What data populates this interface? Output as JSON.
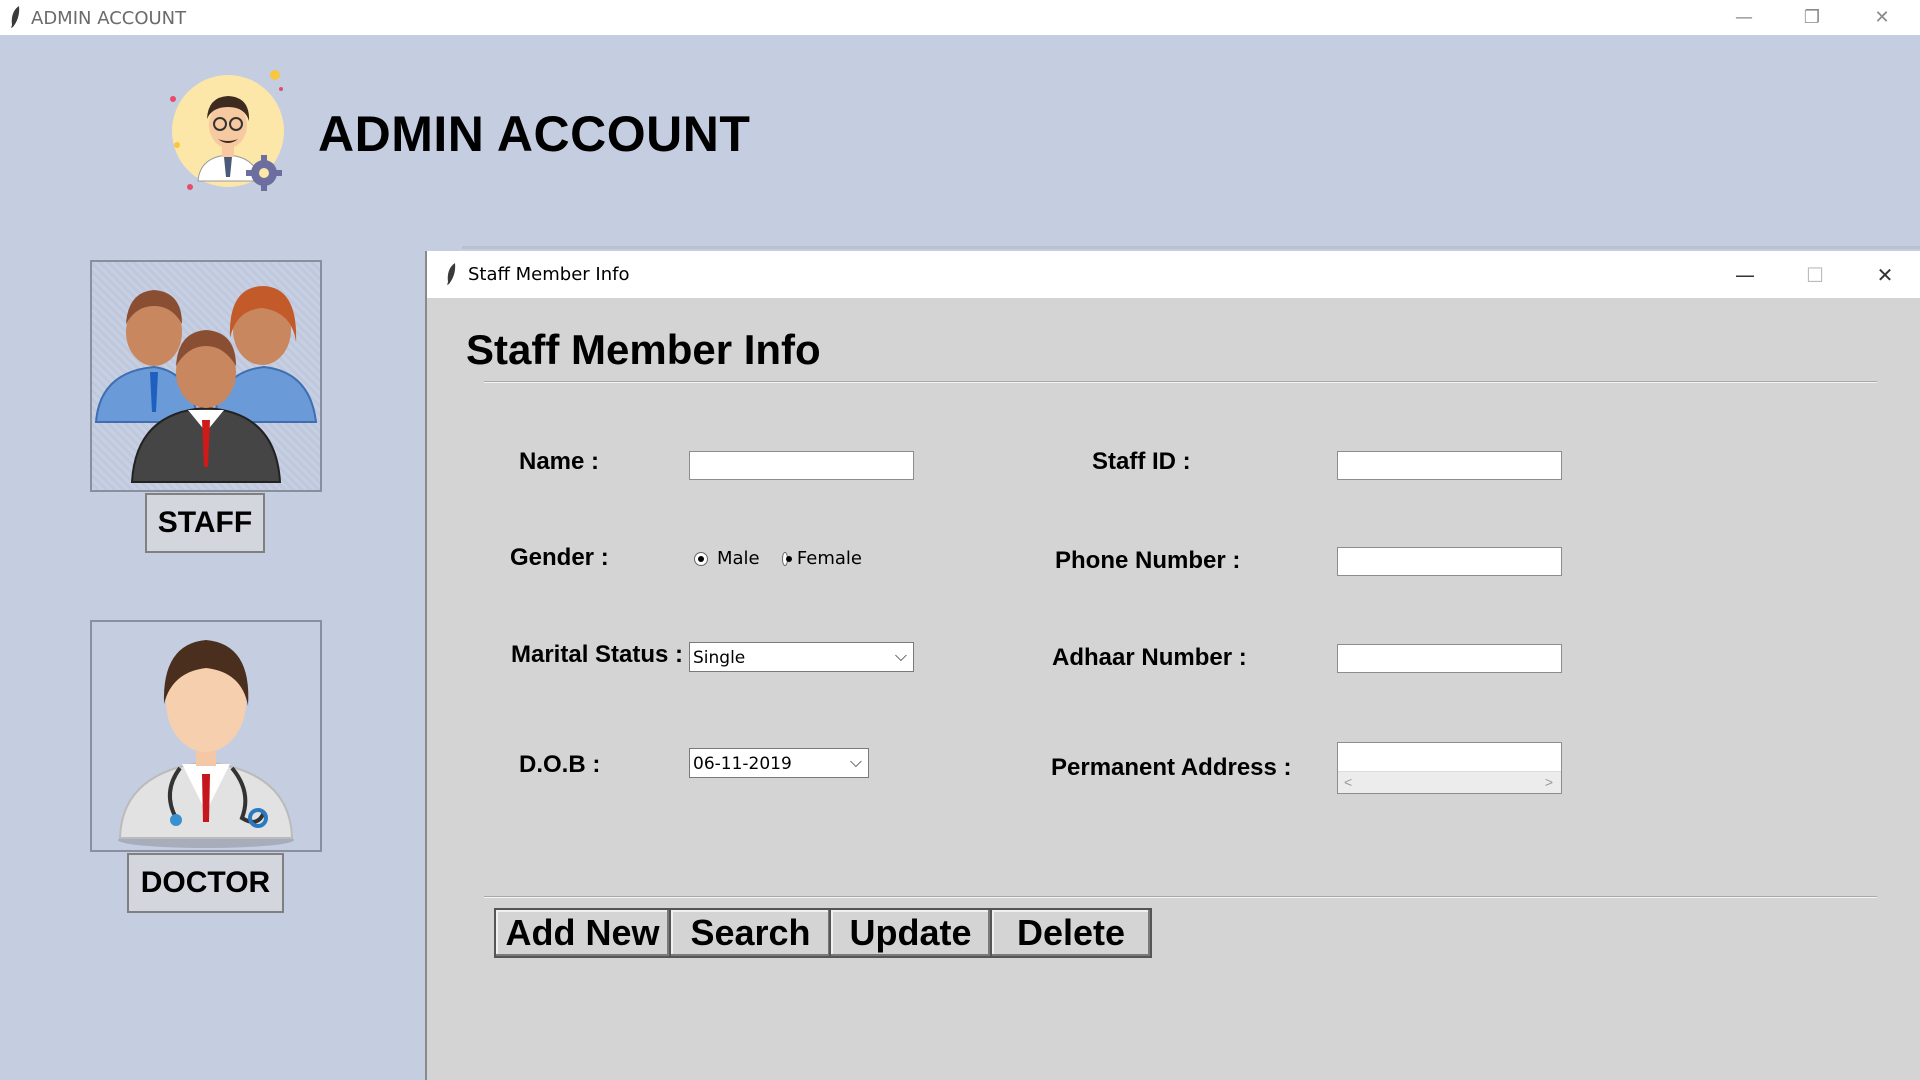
{
  "window": {
    "title": "ADMIN ACCOUNT",
    "minimize_icon": "—",
    "restore_icon": "❐",
    "close_icon": "✕"
  },
  "header": {
    "title": "ADMIN ACCOUNT"
  },
  "sidebar": {
    "staff_label": "STAFF",
    "doctor_label": "DOCTOR"
  },
  "child_window": {
    "title": "Staff Member Info",
    "minimize_icon": "—",
    "maximize_icon": "☐",
    "close_icon": "✕"
  },
  "form": {
    "heading": "Staff Member Info",
    "name_label": "Name :",
    "staff_id_label": "Staff ID :",
    "gender_label": "Gender :",
    "gender_male": "Male",
    "gender_female": "Female",
    "phone_label": "Phone Number :",
    "marital_label": "Marital Status :",
    "marital_value": "Single",
    "adhaar_label": "Adhaar Number :",
    "dob_label": "D.O.B :",
    "dob_value": "06-11-2019",
    "address_label": "Permanent Address :",
    "scroll_left": "<",
    "scroll_right": ">"
  },
  "actions": {
    "add_new": "Add New",
    "search": "Search",
    "update": "Update",
    "delete": "Delete"
  },
  "colors": {
    "background": "#c5cde0",
    "form_background": "#d4d4d4"
  }
}
